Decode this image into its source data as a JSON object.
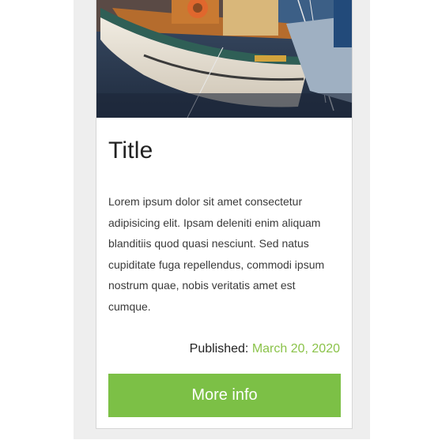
{
  "card": {
    "image_alt": "Sailboat moored at harbor",
    "title": "Title",
    "description": "Lorem ipsum dolor sit amet consectetur adipisicing elit. Ipsam deleniti enim aliquam blanditiis quod quasi nesciunt. Sed natus cupiditate fuga repellendus, commodi ipsum nostrum quae, nobis veritatis amet est cumque.",
    "published_label": "Published:",
    "published_date": "March 20, 2020",
    "button_label": "More info"
  },
  "colors": {
    "accent": "#7cc046",
    "date": "#8bc34a",
    "backdrop": "#eeeeee"
  }
}
